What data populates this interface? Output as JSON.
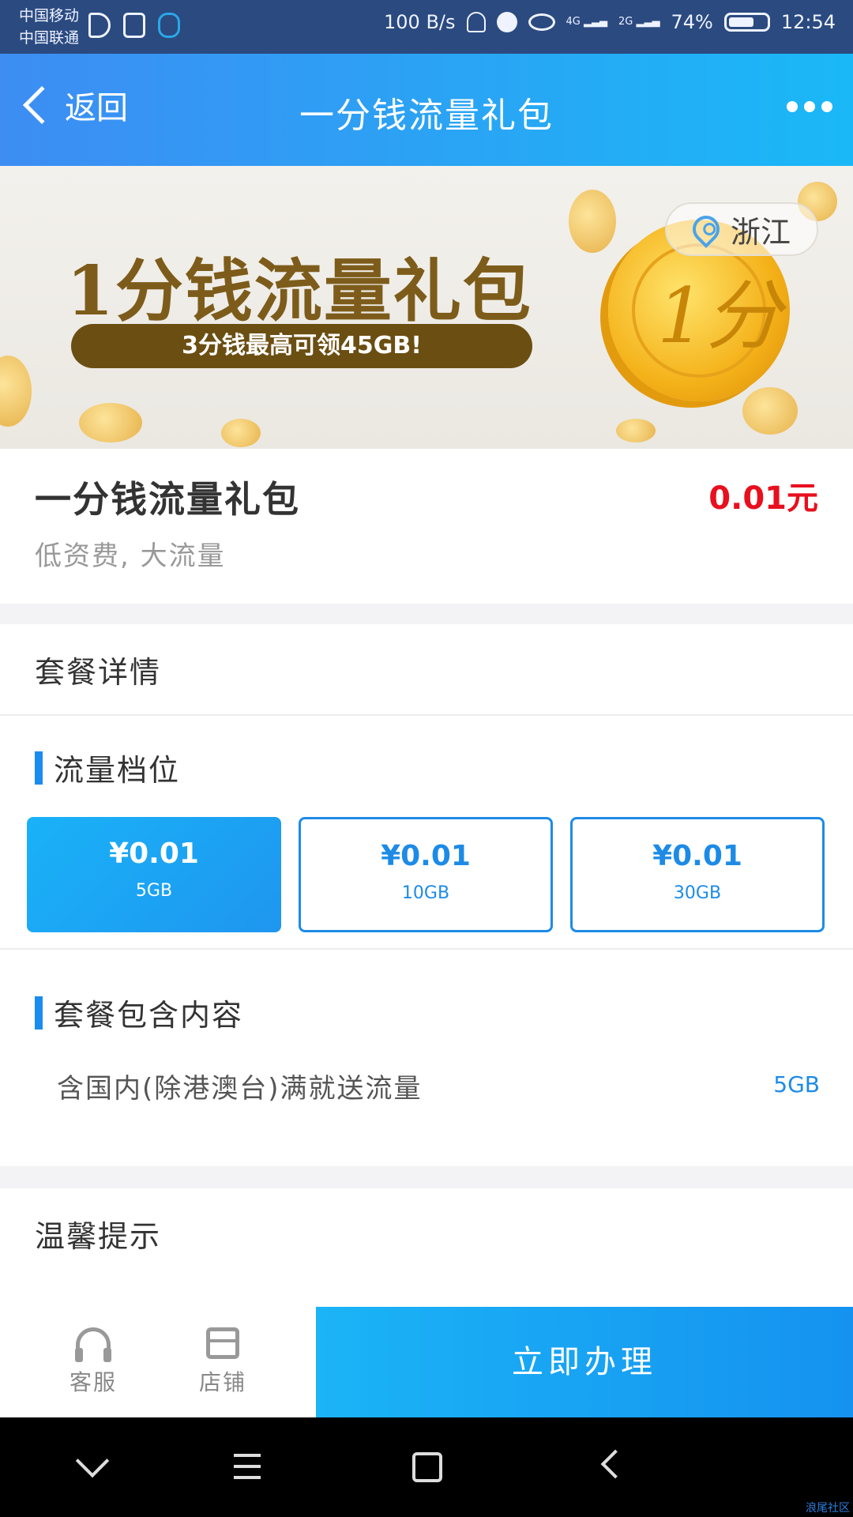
{
  "status_bar": {
    "carrier_1": "中国移动",
    "carrier_2": "中国联通",
    "net_speed": "100 B/s",
    "signal_4g": "4G",
    "signal_2g": "2G",
    "battery": "74%",
    "battery_level": 0.74,
    "time": "12:54"
  },
  "nav": {
    "back_label": "返回",
    "title": "一分钱流量礼包"
  },
  "banner": {
    "headline": "1分钱流量礼包",
    "subline": "3分钱最高可领45GB!",
    "coin_mark": "1分",
    "region": "浙江"
  },
  "product": {
    "title": "一分钱流量礼包",
    "price": "0.01元",
    "subtitle": "低资费, 大流量"
  },
  "details": {
    "section_title": "套餐详情",
    "tier_heading": "流量档位",
    "tiers": [
      {
        "price": "¥0.01",
        "size": "5GB",
        "selected": true
      },
      {
        "price": "¥0.01",
        "size": "10GB",
        "selected": false
      },
      {
        "price": "¥0.01",
        "size": "30GB",
        "selected": false
      }
    ],
    "contents_heading": "套餐包含内容",
    "contents": [
      {
        "label": "含国内(除港澳台)满就送流量",
        "value": "5GB"
      }
    ]
  },
  "tips": {
    "title": "温馨提示"
  },
  "action_bar": {
    "service_label": "客服",
    "store_label": "店铺",
    "cta_label": "立即办理"
  },
  "watermark": "浪尾社区",
  "colors": {
    "accent": "#1a8cf0",
    "price_red": "#e8101e",
    "nav_start": "#3d8df3",
    "nav_end": "#1ab8f6"
  }
}
